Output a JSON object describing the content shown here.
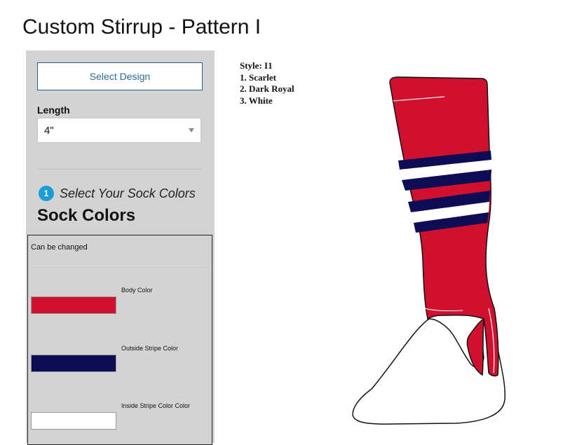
{
  "page": {
    "title": "Custom Stirrup - Pattern I"
  },
  "sidebar": {
    "select_design_label": "Select Design",
    "length_label": "Length",
    "length_value": "4\"",
    "step_number": "1",
    "step_text": "Select Your Sock Colors",
    "heading": "Sock Colors",
    "changeable_note": "Can be changed",
    "colors": [
      {
        "label": "Body Color",
        "color": "#d0102e"
      },
      {
        "label": "Outside Stripe Color",
        "color": "#0d0c55"
      },
      {
        "label": "Inside Stripe Color Color",
        "color": "#ffffff"
      }
    ]
  },
  "style_info": {
    "style": "Style: I1",
    "items": [
      "1. Scarlet",
      "2. Dark Royal",
      "3. White"
    ]
  },
  "sock_preview": {
    "body_color": "#d0102e",
    "stripe_outer_color": "#0d0c55",
    "stripe_inner_color": "#ffffff"
  }
}
